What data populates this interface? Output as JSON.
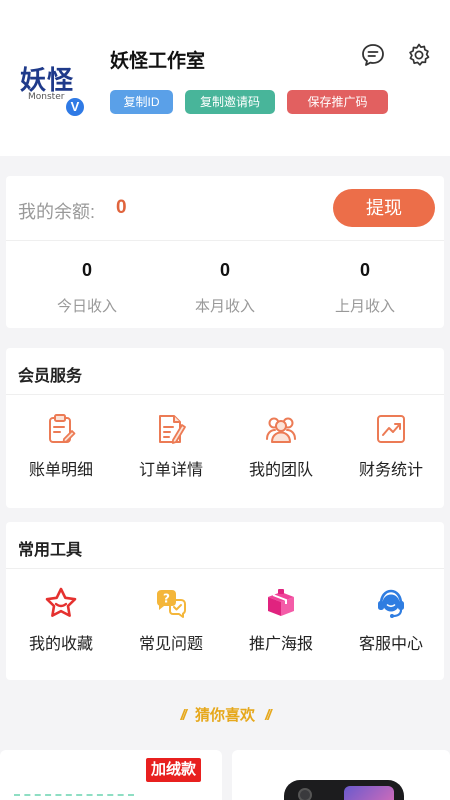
{
  "header": {
    "logo_text": "妖怪",
    "logo_sub": "Monster",
    "vip_letter": "V",
    "shop_name": "妖怪工作室",
    "chips": {
      "copy_id": "复制ID",
      "copy_invite": "复制邀请码",
      "save_poster": "保存推广码"
    }
  },
  "balance": {
    "label": "我的余额:",
    "value": "0",
    "withdraw": "提现",
    "stats": [
      {
        "value": "0",
        "label": "今日收入"
      },
      {
        "value": "0",
        "label": "本月收入"
      },
      {
        "value": "0",
        "label": "上月收入"
      }
    ]
  },
  "member_service": {
    "title": "会员服务",
    "items": [
      {
        "label": "账单明细",
        "icon": "clipboard-edit-icon"
      },
      {
        "label": "订单详情",
        "icon": "document-edit-icon"
      },
      {
        "label": "我的团队",
        "icon": "team-icon"
      },
      {
        "label": "财务统计",
        "icon": "chart-up-icon"
      }
    ]
  },
  "tools": {
    "title": "常用工具",
    "items": [
      {
        "label": "我的收藏",
        "icon": "star-icon"
      },
      {
        "label": "常见问题",
        "icon": "question-chat-icon"
      },
      {
        "label": "推广海报",
        "icon": "gift-box-icon"
      },
      {
        "label": "客服中心",
        "icon": "headset-icon"
      }
    ]
  },
  "guess": {
    "title": "猜你喜欢"
  },
  "products": {
    "left_tag": "加绒款"
  },
  "colors": {
    "accent": "#ec6e49",
    "chip_blue": "#5aa0e8",
    "chip_green": "#48b59a",
    "chip_red": "#e26060",
    "guess_gold": "#e6a81c"
  }
}
